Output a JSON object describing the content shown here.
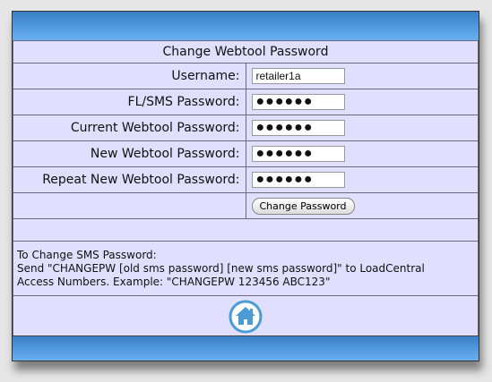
{
  "form": {
    "title": "Change Webtool Password",
    "fields": [
      {
        "label": "Username:",
        "value": "retailer1a",
        "masked": false
      },
      {
        "label": "FL/SMS Password:",
        "value": "●●●●●●",
        "masked": true
      },
      {
        "label": "Current Webtool Password:",
        "value": "●●●●●●",
        "masked": true
      },
      {
        "label": "New Webtool Password:",
        "value": "●●●●●●",
        "masked": true
      },
      {
        "label": "Repeat New Webtool Password:",
        "value": "●●●●●●",
        "masked": true
      }
    ],
    "submit_label": "Change Password"
  },
  "info": {
    "line1": "To Change SMS Password:",
    "line2": "Send \"CHANGEPW [old sms password] [new sms password]\" to LoadCentral",
    "line3": "Access Numbers. Example: \"CHANGEPW 123456 ABC123\""
  },
  "colors": {
    "panel_bg": "#e0e0fe",
    "bar_blue": "#4f98de",
    "home_icon": "#4a9bd6"
  },
  "icons": {
    "home": "home-icon"
  }
}
